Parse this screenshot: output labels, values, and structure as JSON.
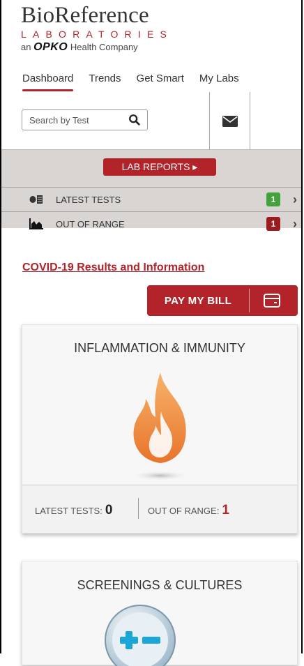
{
  "logo": {
    "name": "BioReference",
    "labs": "LABORATORIES",
    "sub_prefix": "an",
    "sub_brand": "OPKO",
    "sub_suffix": "Health Company"
  },
  "nav": {
    "items": [
      "Dashboard",
      "Trends",
      "Get Smart",
      "My Labs"
    ],
    "active": "Dashboard"
  },
  "search": {
    "placeholder": "Search by Test"
  },
  "lab_reports": {
    "label": "LAB REPORTS ▸"
  },
  "rows": [
    {
      "label": "LATEST TESTS",
      "count": "1",
      "badge_color": "#44a23a"
    },
    {
      "label": "OUT OF RANGE",
      "count": "1",
      "badge_color": "#9b1b1f"
    }
  ],
  "covid_link": "COVID-19 Results and Information",
  "pay": {
    "label": "PAY MY BILL"
  },
  "cards": [
    {
      "title": "INFLAMMATION & IMMUNITY",
      "latest_label": "LATEST TESTS:",
      "latest_value": "0",
      "range_label": "OUT OF RANGE:",
      "range_value": "1"
    },
    {
      "title": "SCREENINGS & CULTURES"
    }
  ],
  "colors": {
    "brand_red": "#b3242a",
    "badge_green": "#44a23a",
    "panel_grey": "#d8d5d3"
  }
}
